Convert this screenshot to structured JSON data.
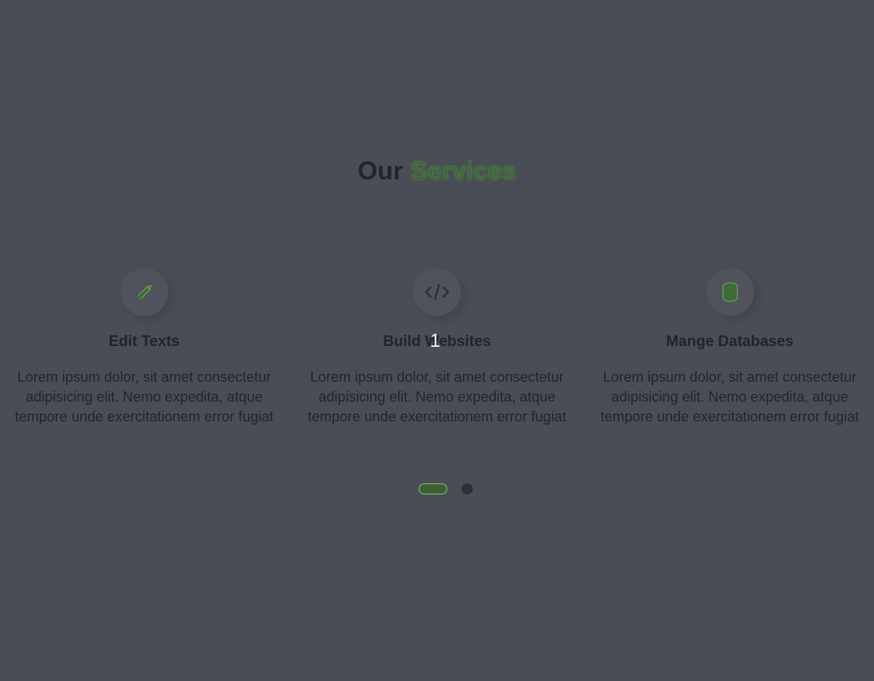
{
  "heading": {
    "prefix": "Our",
    "accent": "Services"
  },
  "colors": {
    "background": "#4a4d56",
    "accent": "#3d6a3b",
    "text": "#23252b",
    "overlay_text": "#f2f2f2"
  },
  "services": [
    {
      "icon": "pencil-icon",
      "title": "Edit Texts",
      "text": "Lorem ipsum dolor, sit amet consectetur adipisicing elit. Nemo expedita, atque tempore unde exercitationem error fugiat"
    },
    {
      "icon": "code-icon",
      "title": "Build Websites",
      "text": "Lorem ipsum dolor, sit amet consectetur adipisicing elit. Nemo expedita, atque tempore unde exercitationem error fugiat"
    },
    {
      "icon": "database-icon",
      "title": "Mange Databases",
      "text": "Lorem ipsum dolor, sit amet consectetur adipisicing elit. Nemo expedita, atque tempore unde exercitationem error fugiat"
    }
  ],
  "overlay": {
    "number": "1"
  },
  "pagination": {
    "total": 2,
    "active": 1
  }
}
